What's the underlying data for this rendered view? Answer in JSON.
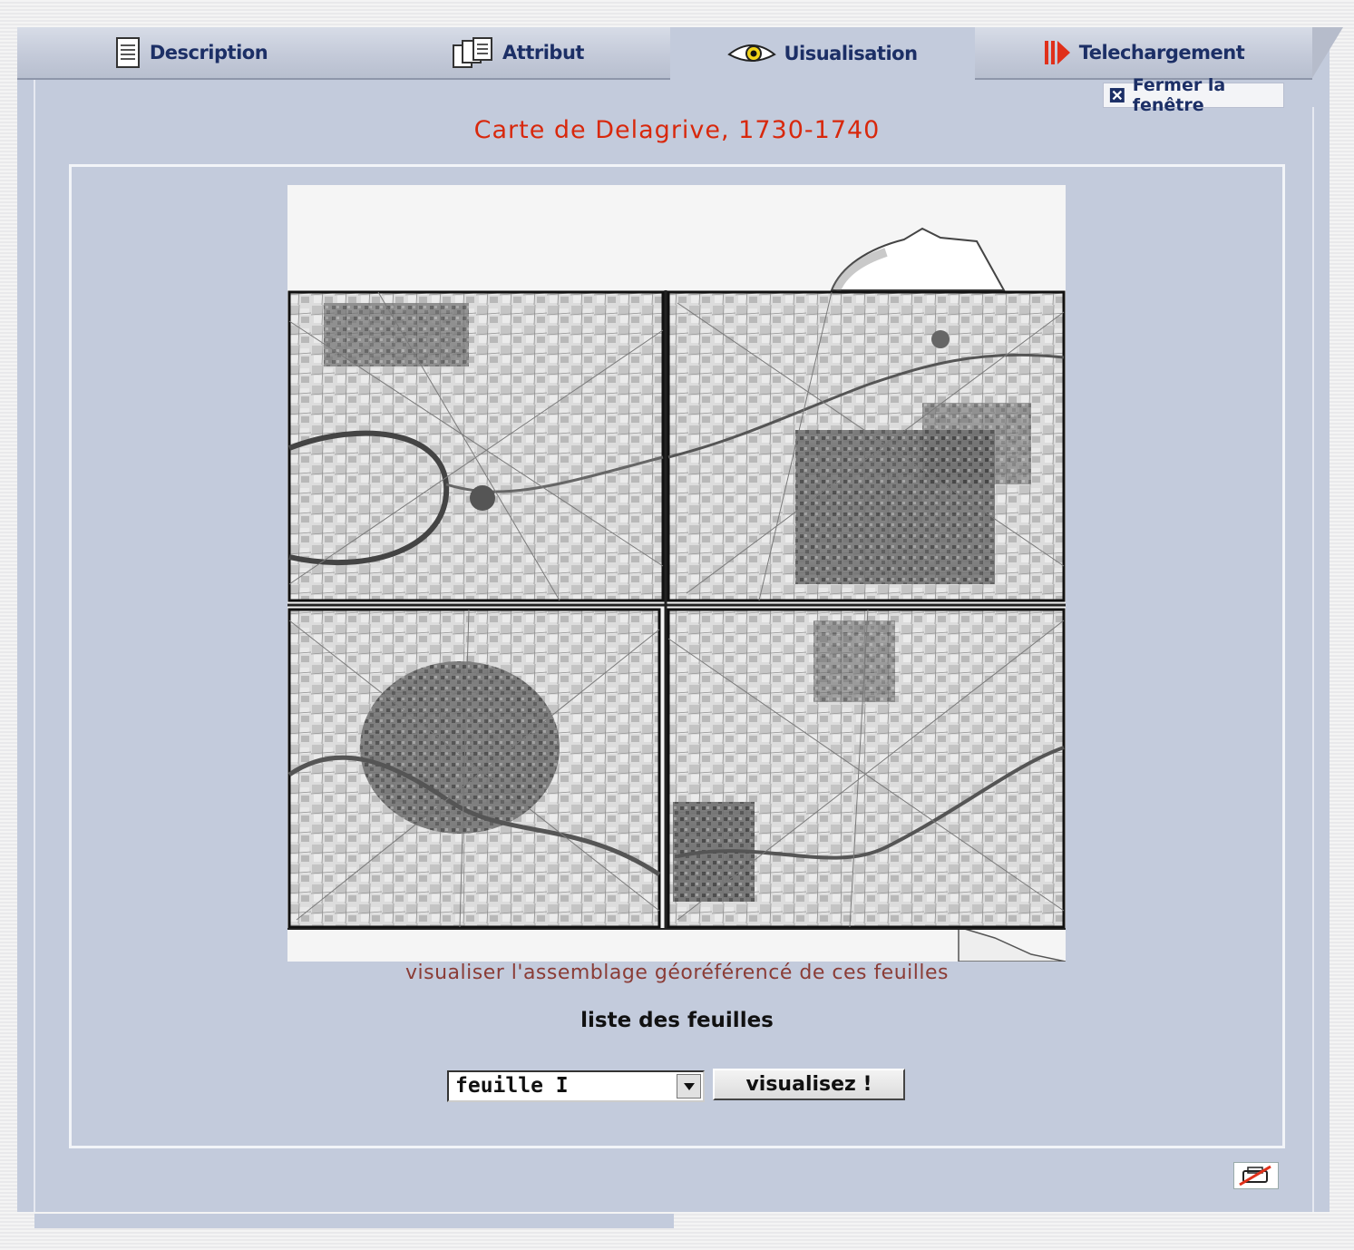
{
  "tabs": [
    {
      "label": "Description",
      "icon": "document-icon",
      "active": false
    },
    {
      "label": "Attribut",
      "icon": "documents-icon",
      "active": false
    },
    {
      "label": "Uisualisation",
      "icon": "eye-icon",
      "active": true
    },
    {
      "label": "Telechargement",
      "icon": "download-arrow-icon",
      "active": false
    }
  ],
  "close_label": "Fermer la fenêtre",
  "title": "Carte de Delagrive, 1730-1740",
  "map_caption": "visualiser l'assemblage géoréférencé de ces feuilles",
  "sheet_list_title": "liste des feuilles",
  "sheet_select": {
    "value": "feuille I"
  },
  "submit_label": "visualisez !",
  "colors": {
    "accent": "#d8280c",
    "tab_text": "#1c2f66",
    "background": "#c3cbdc",
    "caption": "#8a3c36"
  }
}
